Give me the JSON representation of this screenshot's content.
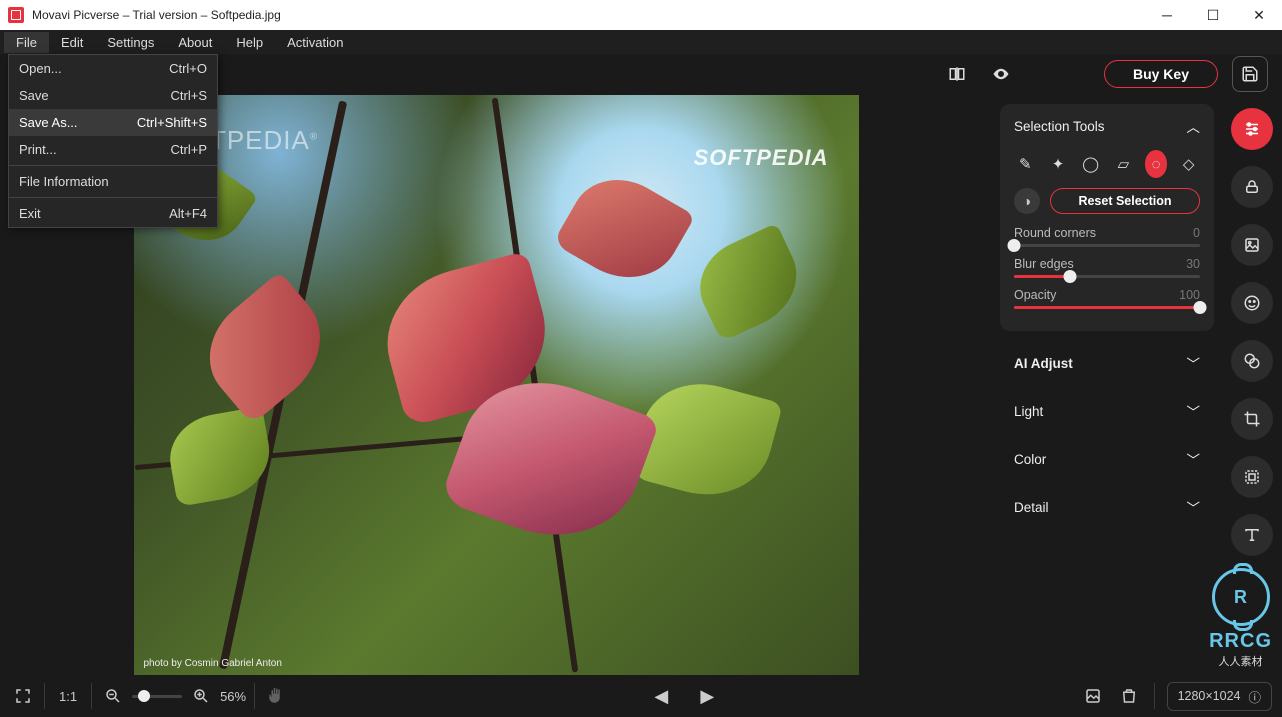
{
  "titlebar": {
    "title": "Movavi Picverse – Trial version – Softpedia.jpg"
  },
  "menubar": [
    "File",
    "Edit",
    "Settings",
    "About",
    "Help",
    "Activation"
  ],
  "file_menu": [
    {
      "label": "Open...",
      "shortcut": "Ctrl+O"
    },
    {
      "label": "Save",
      "shortcut": "Ctrl+S"
    },
    {
      "label": "Save As...",
      "shortcut": "Ctrl+Shift+S",
      "hl": true
    },
    {
      "label": "Print...",
      "shortcut": "Ctrl+P"
    },
    "-",
    {
      "label": "File Information",
      "shortcut": ""
    },
    "-",
    {
      "label": "Exit",
      "shortcut": "Alt+F4"
    }
  ],
  "topbar": {
    "buy_key": "Buy Key"
  },
  "canvas": {
    "watermark1": "SOFTPEDIA",
    "wm1_reg": "®",
    "watermark2": "SOFTPEDIA",
    "credit": "photo by Cosmin Gabriel Anton"
  },
  "panel": {
    "selection_title": "Selection Tools",
    "reset_label": "Reset Selection",
    "sliders": [
      {
        "label": "Round corners",
        "value": "0",
        "pct": 0
      },
      {
        "label": "Blur edges",
        "value": "30",
        "pct": 30
      },
      {
        "label": "Opacity",
        "value": "100",
        "pct": 100
      }
    ],
    "sections": [
      "AI Adjust",
      "Light",
      "Color",
      "Detail"
    ]
  },
  "bottombar": {
    "ratio_label": "1:1",
    "zoom_pct": "56%",
    "dimensions": "1280×1024"
  },
  "rrcg": {
    "big": "RRCG",
    "small": "人人素材"
  }
}
